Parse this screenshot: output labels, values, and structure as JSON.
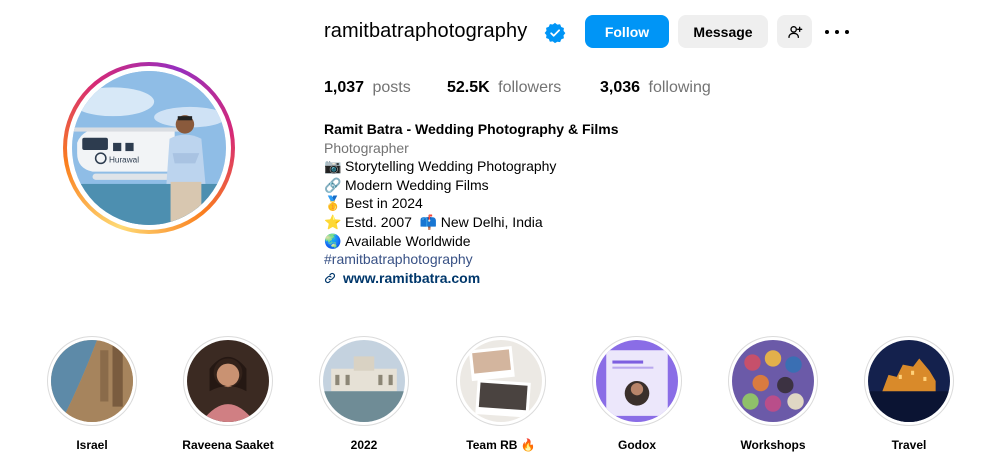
{
  "profile": {
    "username": "ramitbatraphotography",
    "verified": true,
    "follow_label": "Follow",
    "message_label": "Message",
    "stats": {
      "posts_count": "1,037",
      "posts_label": "posts",
      "followers_count": "52.5K",
      "followers_label": "followers",
      "following_count": "3,036",
      "following_label": "following"
    },
    "bio": {
      "name": "Ramit Batra - Wedding Photography & Films",
      "category": "Photographer",
      "lines": [
        {
          "emoji": "📷",
          "text": "Storytelling Wedding Photography"
        },
        {
          "emoji": "🔗",
          "text": "Modern Wedding Films"
        },
        {
          "emoji": "🥇",
          "text": "Best in 2024"
        },
        {
          "emoji": "⭐",
          "text": "Estd. 2007"
        },
        {
          "emoji": "📫",
          "text": "New Delhi, India"
        },
        {
          "emoji": "🌏",
          "text": "Available Worldwide"
        }
      ],
      "hashtag": "#ramitbatraphotography",
      "website": "www.ramitbatra.com"
    }
  },
  "highlights": [
    {
      "label": "Israel"
    },
    {
      "label": "Raveena Saaket"
    },
    {
      "label": "2022"
    },
    {
      "label": "Team RB 🔥"
    },
    {
      "label": "Godox"
    },
    {
      "label": "Workshops"
    },
    {
      "label": "Travel"
    }
  ],
  "colors": {
    "accent": "#0095f6",
    "secondary_button": "#efefef",
    "muted_text": "#737373",
    "link_text": "#00376b"
  }
}
